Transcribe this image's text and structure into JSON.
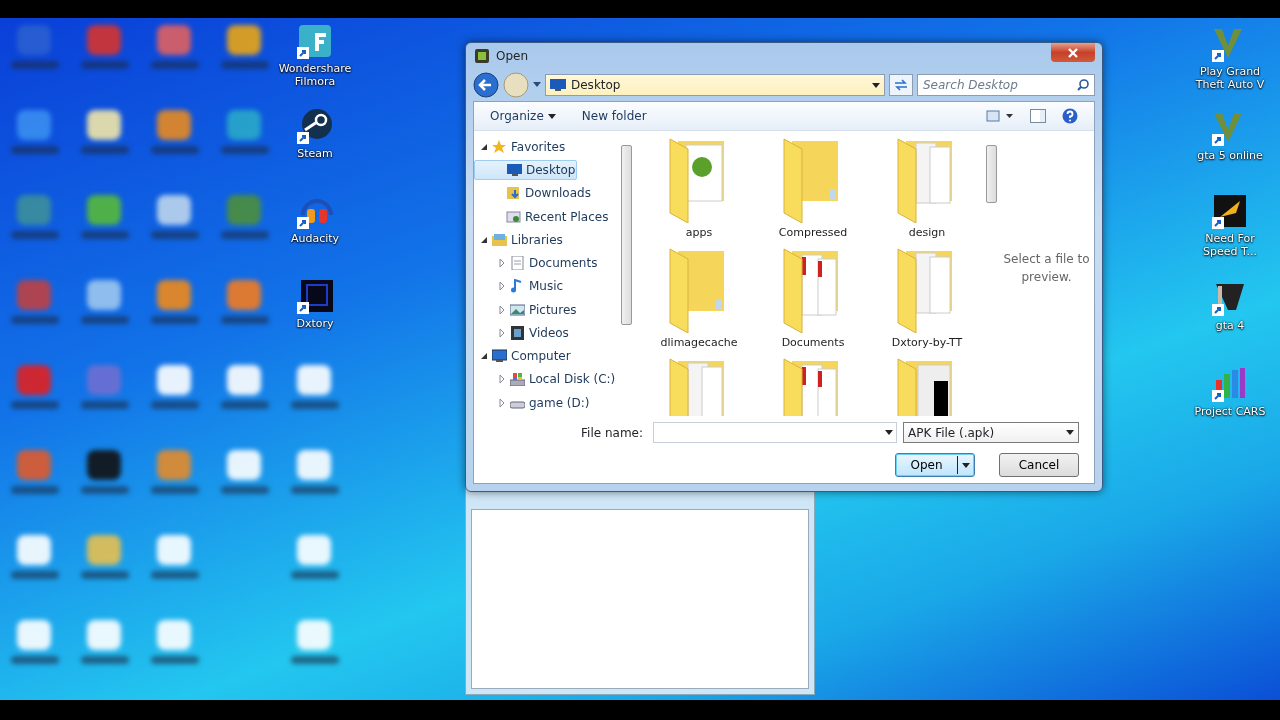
{
  "desktop": {
    "left_icons": [
      {
        "kind": "blurred"
      },
      {
        "kind": "blurred"
      },
      {
        "kind": "blurred"
      },
      {
        "kind": "blurred"
      },
      {
        "kind": "clear",
        "label": "Wondershare Filmora"
      },
      {
        "kind": "blurred"
      },
      {
        "kind": "blurred"
      },
      {
        "kind": "blurred"
      },
      {
        "kind": "blurred"
      },
      {
        "kind": "clear",
        "label": "Steam"
      },
      {
        "kind": "blurred"
      },
      {
        "kind": "blurred"
      },
      {
        "kind": "blurred"
      },
      {
        "kind": "blurred"
      },
      {
        "kind": "clear",
        "label": "Audacity"
      },
      {
        "kind": "blurred"
      },
      {
        "kind": "blurred"
      },
      {
        "kind": "blurred"
      },
      {
        "kind": "blurred"
      },
      {
        "kind": "clear",
        "label": "Dxtory"
      },
      {
        "kind": "blurred"
      },
      {
        "kind": "blurred"
      },
      {
        "kind": "blurred"
      },
      {
        "kind": "blurred"
      },
      {
        "kind": "blurred"
      },
      {
        "kind": "blurred"
      },
      {
        "kind": "blurred"
      },
      {
        "kind": "blurred"
      },
      {
        "kind": "blurred"
      },
      {
        "kind": "blurred"
      },
      {
        "kind": "blurred"
      },
      {
        "kind": "blurred"
      },
      {
        "kind": "blurred"
      },
      {
        "kind": "empty"
      },
      {
        "kind": "blurred"
      },
      {
        "kind": "blurred"
      },
      {
        "kind": "blurred"
      },
      {
        "kind": "blurred"
      },
      {
        "kind": "empty"
      },
      {
        "kind": "blurred"
      }
    ],
    "right_icons": [
      {
        "label": "Play Grand Theft Auto V"
      },
      {
        "label": "gta 5 online"
      },
      {
        "label": "Need For Speed T..."
      },
      {
        "label": "gta 4"
      },
      {
        "label": "Project CARS"
      }
    ]
  },
  "dialog": {
    "title": "Open",
    "address": "Desktop",
    "search": {
      "placeholder": "Search Desktop"
    },
    "toolbar": [
      "Organize",
      "New folder"
    ],
    "tree": [
      {
        "label": "Favorites",
        "kind": "star",
        "expanded": true,
        "children": [
          {
            "label": "Desktop",
            "kind": "monitor",
            "selected": true
          },
          {
            "label": "Downloads",
            "kind": "download",
            "selected": false
          },
          {
            "label": "Recent Places",
            "kind": "recent",
            "selected": false
          }
        ]
      },
      {
        "label": "Libraries",
        "kind": "library",
        "expanded": true,
        "children": [
          {
            "label": "Documents",
            "kind": "document",
            "expanded": false
          },
          {
            "label": "Music",
            "kind": "music",
            "expanded": false
          },
          {
            "label": "Pictures",
            "kind": "picture",
            "expanded": false
          },
          {
            "label": "Videos",
            "kind": "video",
            "expanded": false
          }
        ]
      },
      {
        "label": "Computer",
        "kind": "computer",
        "expanded": true,
        "children": [
          {
            "label": "Local Disk (C:)",
            "kind": "disk",
            "expanded": false
          },
          {
            "label": "game (D:)",
            "kind": "drive",
            "expanded": false
          }
        ]
      }
    ],
    "folders": [
      {
        "label": "apps",
        "kind": "torrent"
      },
      {
        "label": "Compressed",
        "kind": "plain"
      },
      {
        "label": "design",
        "kind": "papers"
      },
      {
        "label": "dlimagecache",
        "kind": "plain"
      },
      {
        "label": "Documents",
        "kind": "pdf"
      },
      {
        "label": "Dxtory-by-TT",
        "kind": "papers"
      },
      {
        "kind": "papers"
      },
      {
        "kind": "pdf"
      },
      {
        "kind": "dark"
      }
    ],
    "preview": "Select a file to preview.",
    "file_name_label": "File name:",
    "file_type": "APK File (.apk)",
    "buttons": [
      "Open",
      "Cancel"
    ]
  }
}
